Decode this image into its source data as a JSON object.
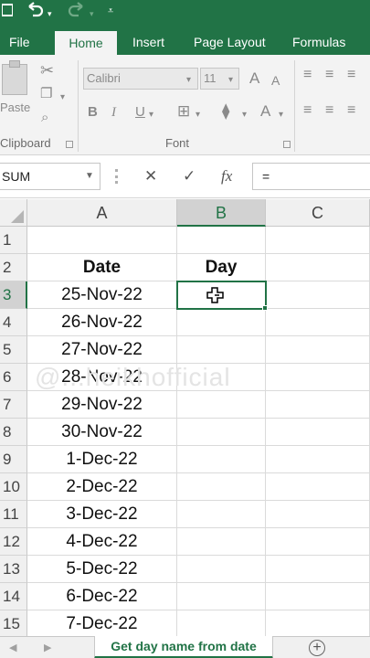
{
  "titlebar": {
    "save_icon": "save-icon",
    "undo_icon": "undo-icon",
    "redo_icon": "redo-icon",
    "customize_icon": "customize-quick-access-icon"
  },
  "ribbon_tabs": [
    "File",
    "Home",
    "Insert",
    "Page Layout",
    "Formulas"
  ],
  "active_tab": "Home",
  "ribbon": {
    "paste_label": "Paste",
    "clipboard_group": "Clipboard",
    "font_group": "Font",
    "font_name": "Calibri",
    "font_size": "11",
    "bold": "B",
    "italic": "I",
    "underline": "U",
    "grow_font": "A",
    "shrink_font": "A",
    "font_color": "A"
  },
  "formula_bar": {
    "name_box": "SUM",
    "cancel_icon": "cancel-icon",
    "enter_icon": "enter-icon",
    "fx_label": "fx",
    "formula": "="
  },
  "columns": [
    "A",
    "B",
    "C"
  ],
  "rows": [
    {
      "num": "1",
      "a": "",
      "b": ""
    },
    {
      "num": "2",
      "a": "Date",
      "b": "Day"
    },
    {
      "num": "3",
      "a": "25-Nov-22",
      "b": ""
    },
    {
      "num": "4",
      "a": "26-Nov-22",
      "b": ""
    },
    {
      "num": "5",
      "a": "27-Nov-22",
      "b": ""
    },
    {
      "num": "6",
      "a": "28-Nov-22",
      "b": ""
    },
    {
      "num": "7",
      "a": "29-Nov-22",
      "b": ""
    },
    {
      "num": "8",
      "a": "30-Nov-22",
      "b": ""
    },
    {
      "num": "9",
      "a": "1-Dec-22",
      "b": ""
    },
    {
      "num": "10",
      "a": "2-Dec-22",
      "b": ""
    },
    {
      "num": "11",
      "a": "3-Dec-22",
      "b": ""
    },
    {
      "num": "12",
      "a": "4-Dec-22",
      "b": ""
    },
    {
      "num": "13",
      "a": "5-Dec-22",
      "b": ""
    },
    {
      "num": "14",
      "a": "6-Dec-22",
      "b": ""
    },
    {
      "num": "15",
      "a": "7-Dec-22",
      "b": ""
    }
  ],
  "active_cell": "B3",
  "watermark": "@...heikhofficial",
  "sheet_tab": "Get day name from date",
  "add_sheet_icon": "add-sheet-icon",
  "accent_color": "#217346"
}
